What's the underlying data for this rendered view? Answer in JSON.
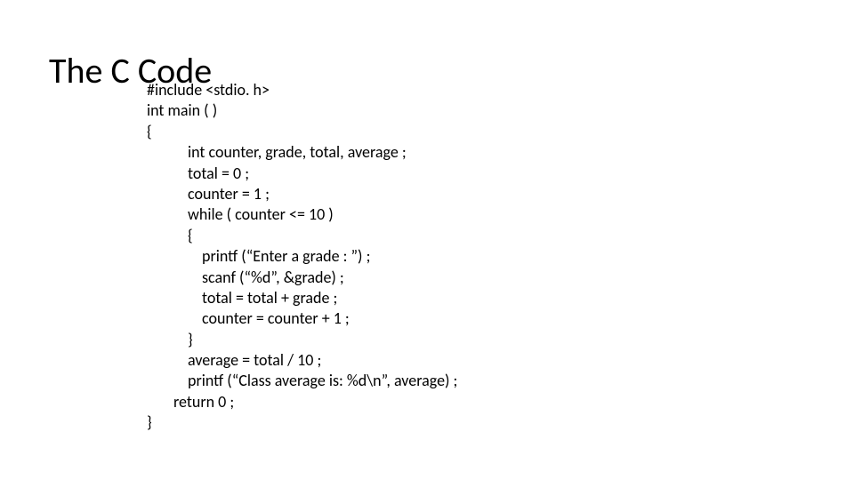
{
  "title": "The C Code",
  "code": {
    "l0": "#include <stdio. h>",
    "l1": "int main ( )",
    "l2": "{",
    "l3": "int  counter, grade, total, average ;",
    "l4": "total = 0 ;",
    "l5": "counter = 1 ;",
    "l6": "while ( counter <= 10 )",
    "l7": "{",
    "l8": "printf (“Enter a grade : ”) ;",
    "l9": "scanf (“%d”, &grade) ;",
    "l10": "total = total + grade ;",
    "l11": "counter = counter + 1 ;",
    "l12": "}",
    "l13": "average = total / 10 ;",
    "l14": "printf (“Class average is: %d\\n”, average) ;",
    "l15": "return 0 ;",
    "l16": "}"
  }
}
